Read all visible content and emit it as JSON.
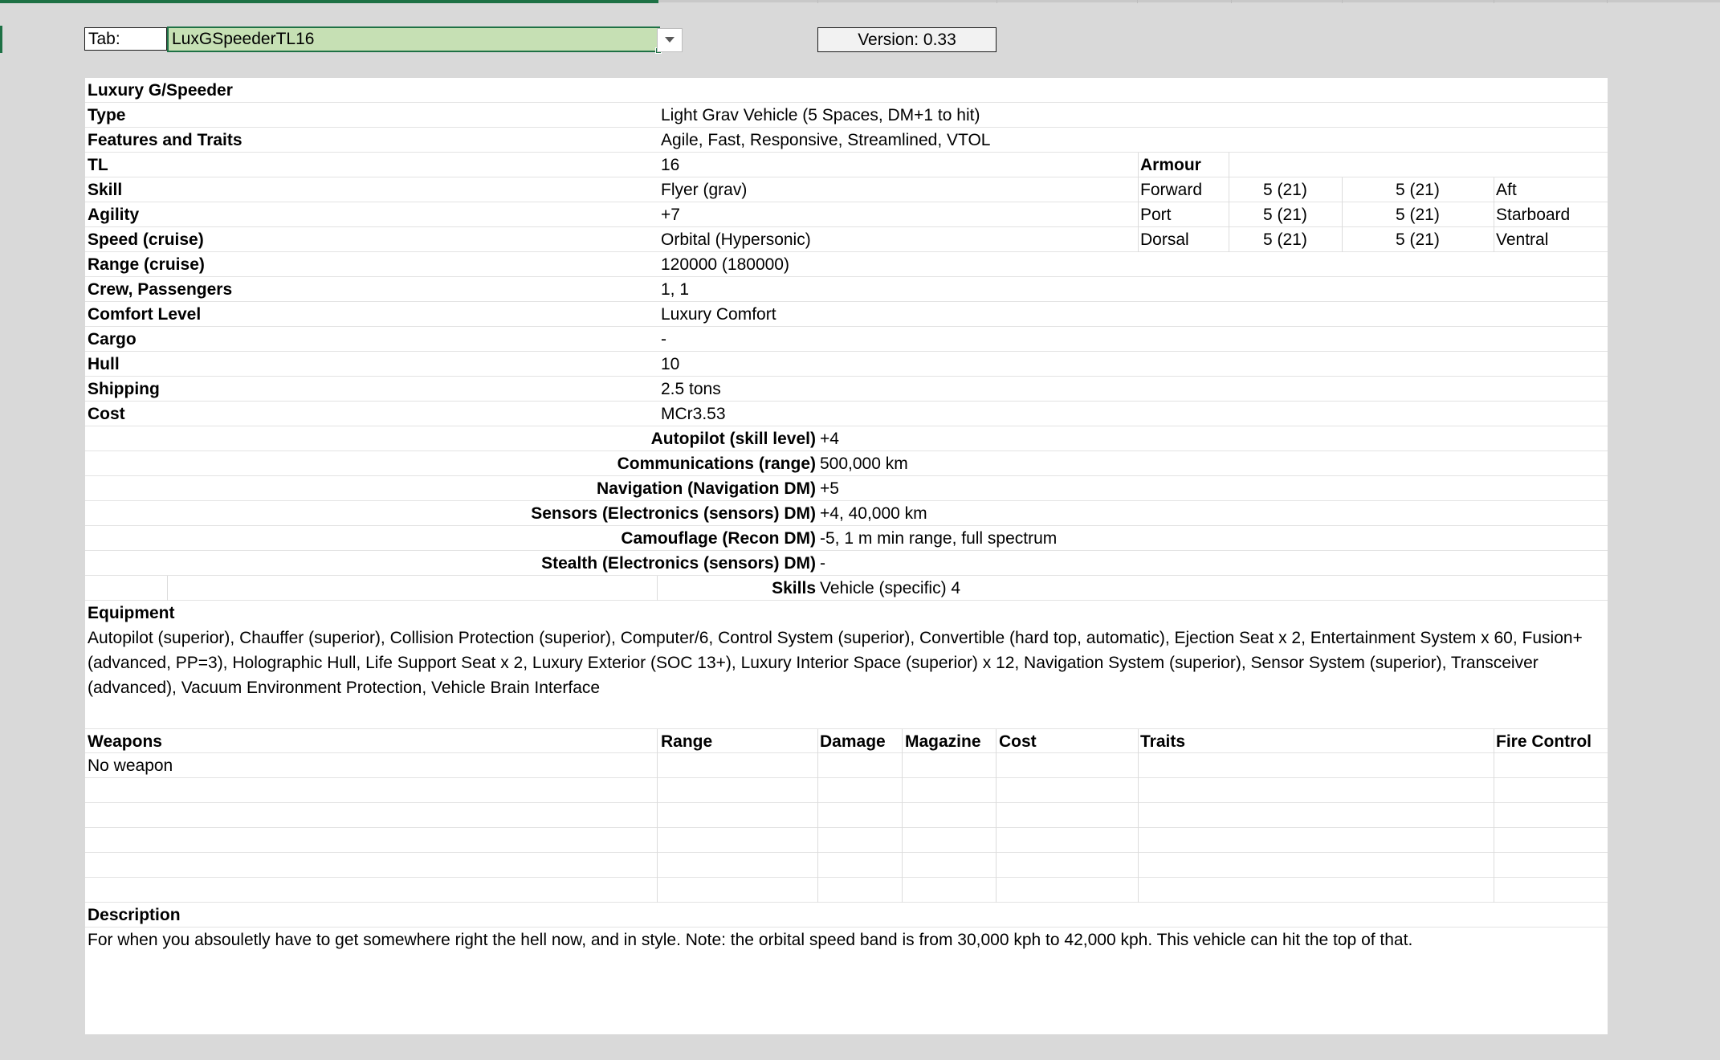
{
  "toolbar": {
    "tab_label": "Tab:",
    "tab_value": "LuxGSpeederTL16",
    "version": "Version: 0.33"
  },
  "vehicle": {
    "name": "Luxury G/Speeder",
    "stats": [
      {
        "label": "Type",
        "value": "Light Grav Vehicle (5 Spaces, DM+1 to hit)"
      },
      {
        "label": "Features and Traits",
        "value": "Agile, Fast, Responsive, Streamlined, VTOL"
      },
      {
        "label": "TL",
        "value": "16"
      },
      {
        "label": "Skill",
        "value": "Flyer (grav)"
      },
      {
        "label": "Agility",
        "value": "+7"
      },
      {
        "label": "Speed (cruise)",
        "value": "Orbital (Hypersonic)"
      },
      {
        "label": "Range (cruise)",
        "value": "120000 (180000)"
      },
      {
        "label": "Crew, Passengers",
        "value": "1, 1"
      },
      {
        "label": "Comfort Level",
        "value": "Luxury Comfort"
      },
      {
        "label": "Cargo",
        "value": "-"
      },
      {
        "label": "Hull",
        "value": "10"
      },
      {
        "label": "Shipping",
        "value": "2.5 tons"
      },
      {
        "label": "Cost",
        "value": "MCr3.53"
      }
    ],
    "armour": {
      "title": "Armour",
      "rows": [
        {
          "left": "Forward",
          "a": "5 (21)",
          "b": "5 (21)",
          "right": "Aft"
        },
        {
          "left": "Port",
          "a": "5 (21)",
          "b": "5 (21)",
          "right": "Starboard"
        },
        {
          "left": "Dorsal",
          "a": "5 (21)",
          "b": "5 (21)",
          "right": "Ventral"
        }
      ]
    },
    "systems": [
      {
        "label": "Autopilot (skill level)",
        "value": "+4"
      },
      {
        "label": "Communications (range)",
        "value": "500,000 km"
      },
      {
        "label": "Navigation (Navigation DM)",
        "value": "+5"
      },
      {
        "label": "Sensors (Electronics (sensors) DM)",
        "value": "+4, 40,000 km"
      },
      {
        "label": "Camouflage (Recon DM)",
        "value": "-5, 1 m min range, full spectrum"
      },
      {
        "label": "Stealth (Electronics (sensors) DM)",
        "value": "-"
      },
      {
        "label": "Skills",
        "value": "Vehicle (specific) 4"
      }
    ],
    "equipment": {
      "title": "Equipment",
      "text": "Autopilot (superior), Chauffer (superior), Collision Protection (superior), Computer/6, Control System (superior), Convertible (hard top, automatic), Ejection Seat x 2, Entertainment System x 60, Fusion+ (advanced, PP=3), Holographic Hull, Life Support Seat x 2, Luxury Exterior (SOC 13+), Luxury Interior Space (superior) x 12, Navigation System (superior), Sensor System (superior), Transceiver (advanced), Vacuum Environment Protection, Vehicle Brain Interface"
    },
    "weapons": {
      "headers": {
        "name": "Weapons",
        "range": "Range",
        "damage": "Damage",
        "magazine": "Magazine",
        "cost": "Cost",
        "traits": "Traits",
        "fire_control": "Fire Control"
      },
      "first": "No weapon"
    },
    "description": {
      "title": "Description",
      "text": "For when you absouletly have to get somewhere right the hell now, and in style. Note: the orbital speed band is from 30,000 kph to 42,000 kph. This vehicle can hit the top of that."
    }
  }
}
